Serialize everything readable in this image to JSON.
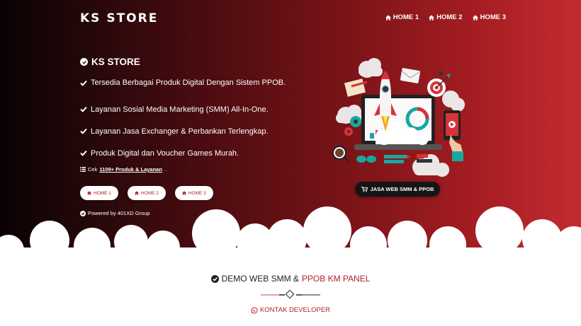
{
  "header": {
    "brand": "KS STORE",
    "nav": [
      {
        "label": "HOME 1",
        "icon": "home-icon"
      },
      {
        "label": "HOME 2",
        "icon": "home-icon"
      },
      {
        "label": "HOME 3",
        "icon": "home-icon"
      }
    ]
  },
  "hero": {
    "title": "KS STORE",
    "features": [
      "Tersedia Berbagai Produk Digital Dengan Sistem PPOB.",
      "Layanan Sosial Media Marketing (SMM) All-In-One.",
      "Layanan Jasa Exchanger & Perbankan Terlengkap.",
      "Produk Digital dan Voucher Games Murah."
    ],
    "cek_prefix": "Cek",
    "cek_link": "1109+ Produk & Layanan",
    "cek_suffix": ".",
    "buttons": [
      "HOME 1",
      "HOME 2",
      "HOME 3"
    ],
    "powered": "Powered by 401XD Group",
    "cta": "JASA WEB SMM & PPOB"
  },
  "section": {
    "title_prefix": "DEMO WEB SMM &",
    "title_accent": "PPOB KM PANEL",
    "contact": "KONTAK DEVELOPER"
  },
  "colors": {
    "accent": "#b32328",
    "dark": "#151515"
  }
}
